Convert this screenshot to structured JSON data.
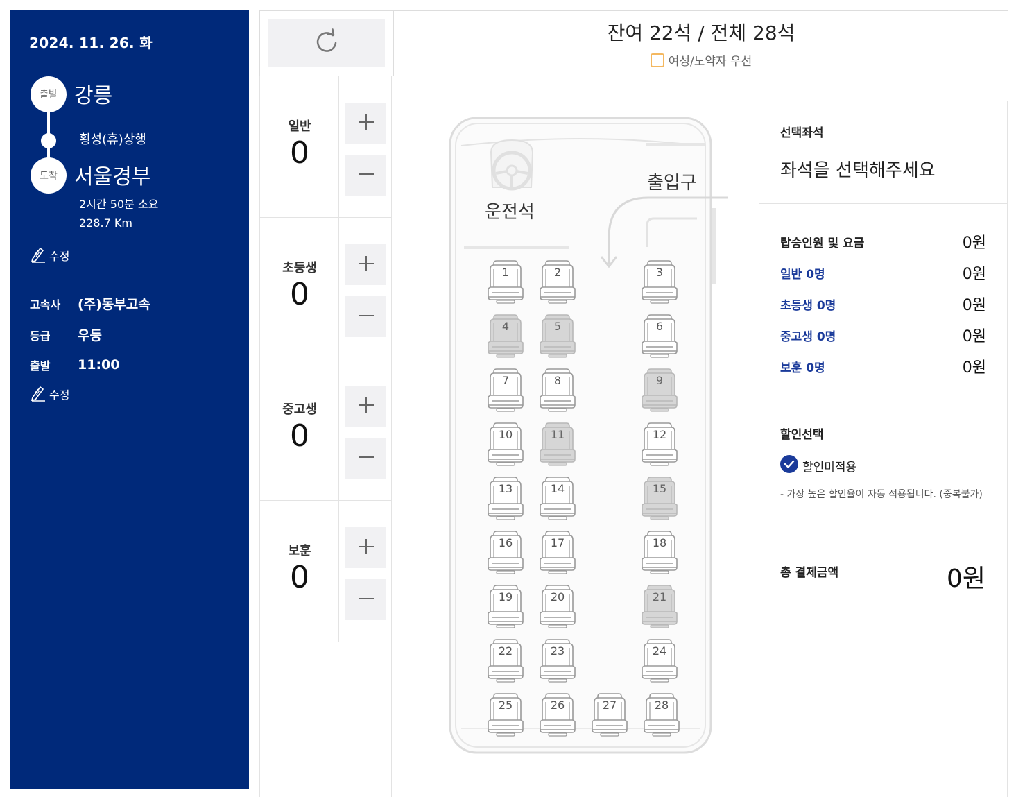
{
  "trip": {
    "date": "2024. 11. 26. 화",
    "departure_badge": "출발",
    "departure_city": "강릉",
    "via": "횡성(휴)상행",
    "arrival_badge": "도착",
    "arrival_city": "서울경부",
    "duration": "2시간 50분 소요",
    "distance": "228.7 Km",
    "edit_label": "수정"
  },
  "bus_info": {
    "company_label": "고속사",
    "company": "(주)동부고속",
    "grade_label": "등급",
    "grade": "우등",
    "depart_label": "출발",
    "depart_time": "11:00",
    "edit_label": "수정"
  },
  "header": {
    "seat_status": "잔여 22석 / 전체 28석",
    "legend_label": "여성/노약자 우선"
  },
  "counters": [
    {
      "label": "일반",
      "count": "0"
    },
    {
      "label": "초등생",
      "count": "0"
    },
    {
      "label": "중고생",
      "count": "0"
    },
    {
      "label": "보훈",
      "count": "0"
    }
  ],
  "busmap": {
    "driver_label": "운전석",
    "entrance_label": "출입구"
  },
  "seats": [
    {
      "n": "1",
      "taken": false
    },
    {
      "n": "2",
      "taken": false
    },
    {
      "n": "3",
      "taken": false
    },
    {
      "n": "4",
      "taken": true
    },
    {
      "n": "5",
      "taken": true
    },
    {
      "n": "6",
      "taken": false
    },
    {
      "n": "7",
      "taken": false
    },
    {
      "n": "8",
      "taken": false
    },
    {
      "n": "9",
      "taken": true
    },
    {
      "n": "10",
      "taken": false
    },
    {
      "n": "11",
      "taken": true
    },
    {
      "n": "12",
      "taken": false
    },
    {
      "n": "13",
      "taken": false
    },
    {
      "n": "14",
      "taken": false
    },
    {
      "n": "15",
      "taken": true
    },
    {
      "n": "16",
      "taken": false
    },
    {
      "n": "17",
      "taken": false
    },
    {
      "n": "18",
      "taken": false
    },
    {
      "n": "19",
      "taken": false
    },
    {
      "n": "20",
      "taken": false
    },
    {
      "n": "21",
      "taken": true
    },
    {
      "n": "22",
      "taken": false
    },
    {
      "n": "23",
      "taken": false
    },
    {
      "n": "24",
      "taken": false
    },
    {
      "n": "25",
      "taken": false
    },
    {
      "n": "26",
      "taken": false
    },
    {
      "n": "27",
      "taken": false
    },
    {
      "n": "28",
      "taken": false
    }
  ],
  "summary": {
    "selected_title": "선택좌석",
    "selected_msg": "좌석을 선택해주세요",
    "fares": [
      {
        "label": "탑승인원 및 요금",
        "value": "0원"
      },
      {
        "label": "일반 0명",
        "value": "0원"
      },
      {
        "label": "초등생 0명",
        "value": "0원"
      },
      {
        "label": "중고생 0명",
        "value": "0원"
      },
      {
        "label": "보훈 0명",
        "value": "0원"
      }
    ],
    "discount_title": "할인선택",
    "discount_option": "할인미적용",
    "discount_note": "- 가장 높은 할인율이 자동 적용됩니다. (중복불가)",
    "total_label": "총 결제금액",
    "total_value": "0원"
  },
  "colors": {
    "sidebar_bg": "#00297a",
    "accent_blue": "#1a3a9a",
    "priority_seat_border": "#f4b860",
    "taken_seat": "#d6d6d6"
  }
}
